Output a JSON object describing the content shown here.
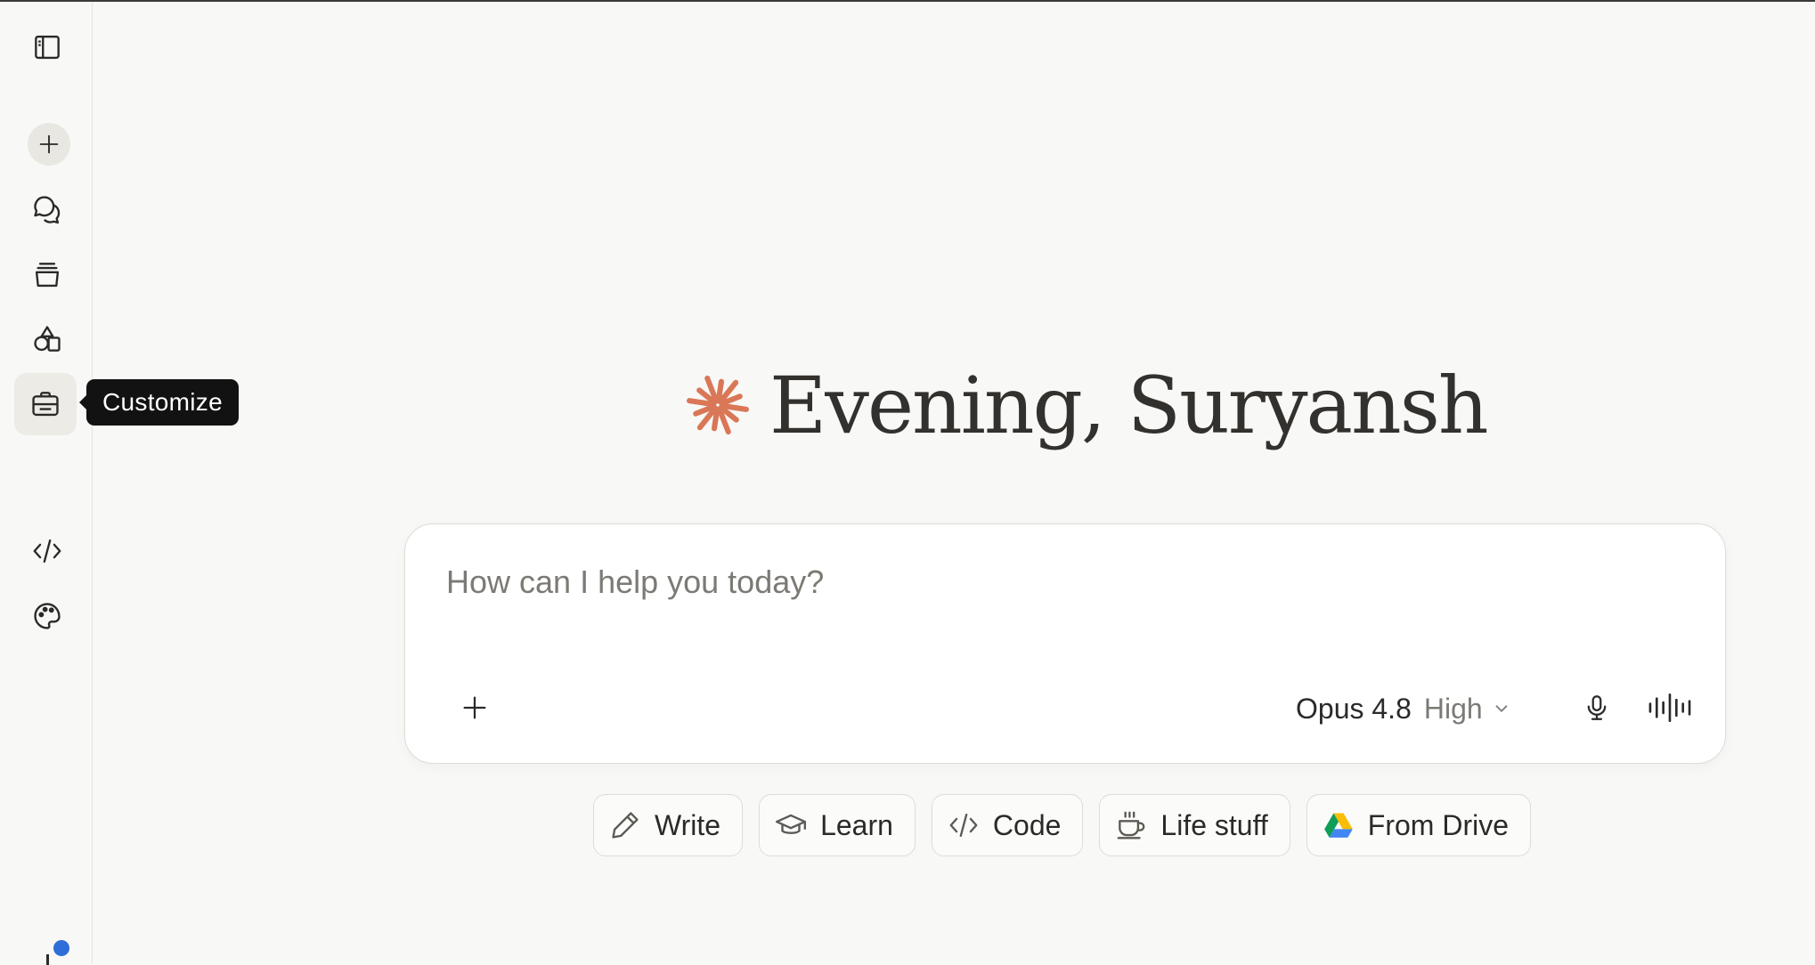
{
  "sidebar": {
    "items": [
      {
        "id": "toggle",
        "icon": "sidebar-toggle-icon"
      },
      {
        "id": "new",
        "icon": "plus-icon"
      },
      {
        "id": "chats",
        "icon": "chats-icon"
      },
      {
        "id": "projects",
        "icon": "stack-icon"
      },
      {
        "id": "artifacts",
        "icon": "shapes-icon"
      },
      {
        "id": "customize",
        "icon": "briefcase-icon"
      },
      {
        "id": "code",
        "icon": "code-icon"
      },
      {
        "id": "design",
        "icon": "palette-icon"
      }
    ],
    "tooltip": "Customize"
  },
  "greeting": {
    "text": "Evening, Suryansh",
    "accent_color": "#d97757"
  },
  "composer": {
    "placeholder": "How can I help you today?",
    "model": "Opus 4.8",
    "effort": "High"
  },
  "chips": [
    {
      "label": "Write",
      "icon": "pencil-icon"
    },
    {
      "label": "Learn",
      "icon": "graduation-cap-icon"
    },
    {
      "label": "Code",
      "icon": "code-icon"
    },
    {
      "label": "Life stuff",
      "icon": "coffee-cup-icon"
    },
    {
      "label": "From Drive",
      "icon": "google-drive-icon"
    }
  ],
  "colors": {
    "background": "#f8f8f6",
    "tooltip_bg": "#121212",
    "notification_dot": "#2f6ed8"
  }
}
